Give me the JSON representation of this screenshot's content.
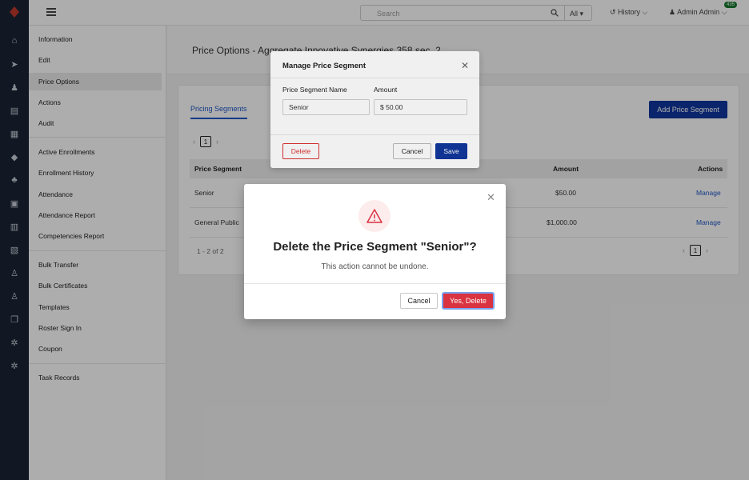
{
  "header": {
    "search_placeholder": "Search",
    "search_scope": "All ▾",
    "history_label": "History ⌵",
    "user_label": "Admin Admin ⌵",
    "notification_count": "435"
  },
  "rail_icons": [
    "home-icon",
    "send-icon",
    "user-search-icon",
    "inbox-icon",
    "calendar-icon",
    "graduation-cap-icon",
    "org-chart-icon",
    "save-icon",
    "books-icon",
    "certificate-icon",
    "person-icon",
    "person-badge-icon",
    "copy-icon",
    "gear-icon",
    "settings-icon"
  ],
  "sidebar": {
    "items": [
      {
        "label": "Information"
      },
      {
        "label": "Edit"
      },
      {
        "label": "Price Options"
      },
      {
        "label": "Actions"
      },
      {
        "label": "Audit"
      },
      {
        "label": "Active Enrollments"
      },
      {
        "label": "Enrollment History"
      },
      {
        "label": "Attendance"
      },
      {
        "label": "Attendance Report"
      },
      {
        "label": "Competencies Report"
      },
      {
        "label": "Bulk Transfer"
      },
      {
        "label": "Bulk Certificates"
      },
      {
        "label": "Templates"
      },
      {
        "label": "Roster Sign In"
      },
      {
        "label": "Coupon"
      },
      {
        "label": "Task Records"
      }
    ]
  },
  "page": {
    "title": "Price Options - Aggregate Innovative Synergies 358 sec. 2",
    "tab_label": "Pricing Segments",
    "add_button": "Add Price Segment",
    "page_number": "1",
    "columns": {
      "segment": "Price Segment",
      "amount": "Amount",
      "actions": "Actions"
    },
    "rows": [
      {
        "segment": "Senior",
        "amount": "$50.00",
        "action": "Manage"
      },
      {
        "segment": "General Public",
        "amount": "$1,000.00",
        "action": "Manage"
      }
    ],
    "record_count": "1 - 2 of 2"
  },
  "manage_modal": {
    "title": "Manage Price Segment",
    "name_label": "Price Segment Name",
    "amount_label": "Amount",
    "name_value": "Senior",
    "amount_value": "$ 50.00",
    "delete_button": "Delete",
    "cancel_button": "Cancel",
    "save_button": "Save"
  },
  "confirm_dialog": {
    "title": "Delete the Price Segment \"Senior\"?",
    "message": "This action cannot be undone.",
    "cancel_button": "Cancel",
    "confirm_button": "Yes, Delete"
  },
  "colors": {
    "rail_bg": "#1b2435",
    "primary": "#10389e",
    "link": "#1f57c7",
    "danger": "#d93240",
    "badge": "#1a7a2e"
  }
}
